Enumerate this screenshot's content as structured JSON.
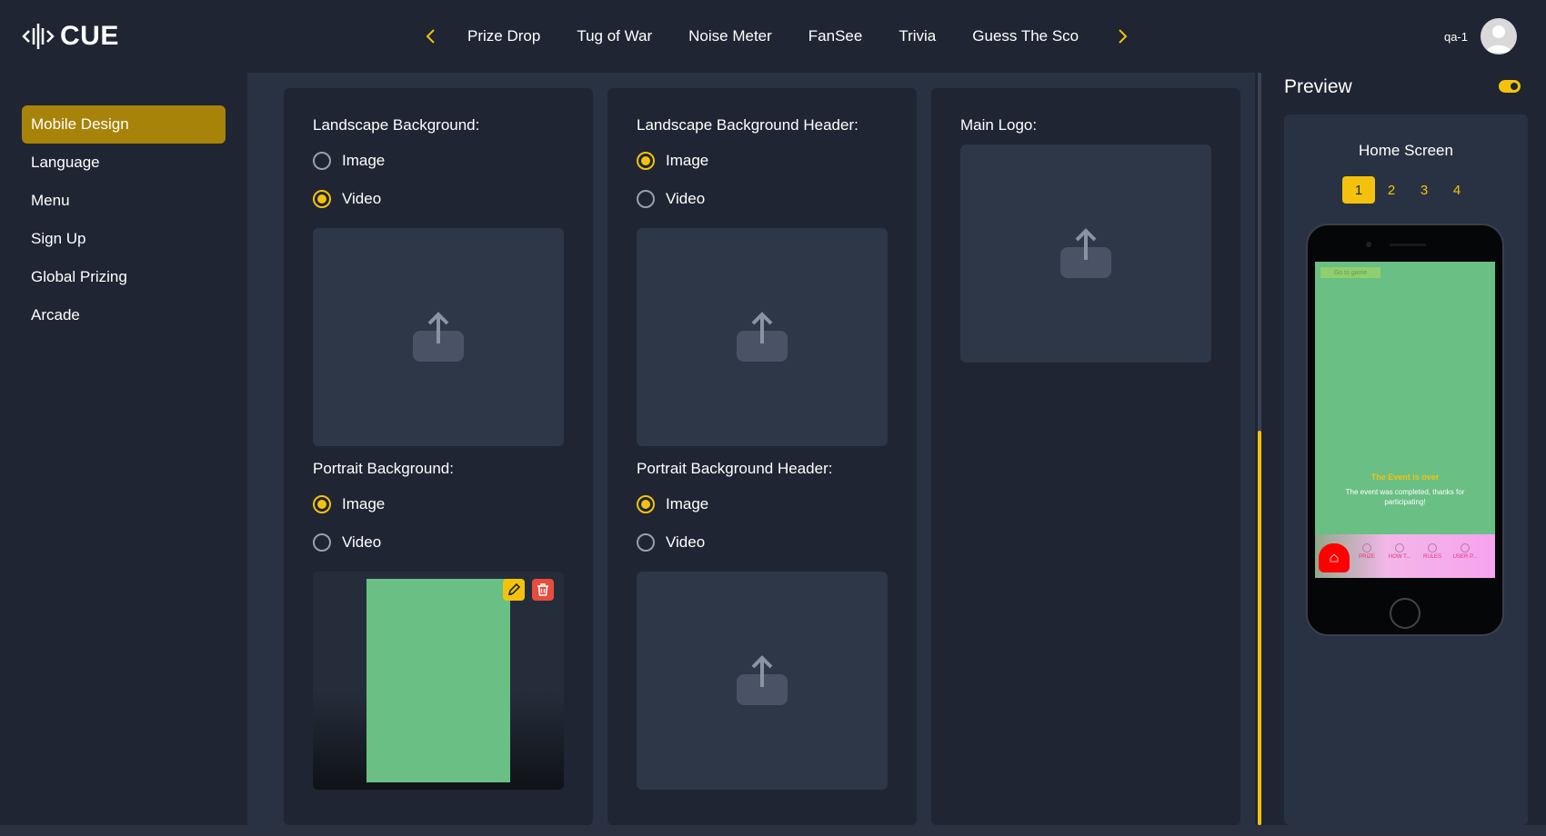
{
  "brand": {
    "name": "CUE"
  },
  "topnav": {
    "items": [
      "Prize Drop",
      "Tug of War",
      "Noise Meter",
      "FanSee",
      "Trivia",
      "Guess The Sco"
    ]
  },
  "user": {
    "name": "qa-1"
  },
  "sidebar": {
    "items": [
      {
        "label": "Mobile Design",
        "active": true
      },
      {
        "label": "Language",
        "active": false
      },
      {
        "label": "Menu",
        "active": false
      },
      {
        "label": "Sign Up",
        "active": false
      },
      {
        "label": "Global Prizing",
        "active": false
      },
      {
        "label": "Arcade",
        "active": false
      }
    ]
  },
  "cards": {
    "landscape_bg": {
      "label": "Landscape Background:",
      "options": [
        "Image",
        "Video"
      ],
      "selected": "Video"
    },
    "portrait_bg": {
      "label": "Portrait Background:",
      "options": [
        "Image",
        "Video"
      ],
      "selected": "Image"
    },
    "landscape_header": {
      "label": "Landscape Background Header:",
      "options": [
        "Image",
        "Video"
      ],
      "selected": "Image"
    },
    "portrait_header": {
      "label": "Portrait Background Header:",
      "options": [
        "Image",
        "Video"
      ],
      "selected": "Image"
    },
    "main_logo": {
      "label": "Main Logo:"
    }
  },
  "preview": {
    "title": "Preview",
    "toggle_on": true,
    "screen_title": "Home Screen",
    "steps": [
      "1",
      "2",
      "3",
      "4"
    ],
    "active_step": "1",
    "phone": {
      "go_button": "Go to game",
      "event_title": "The Event is over",
      "event_message": "The event was completed, thanks for participating!",
      "tabs": [
        "PRIZE",
        "HOW T...",
        "RULES",
        "USER P..."
      ],
      "background_color": "#6abf84"
    }
  },
  "colors": {
    "accent": "#f4c20d",
    "active_sidebar": "#a8830a",
    "danger": "#e74c3c"
  }
}
